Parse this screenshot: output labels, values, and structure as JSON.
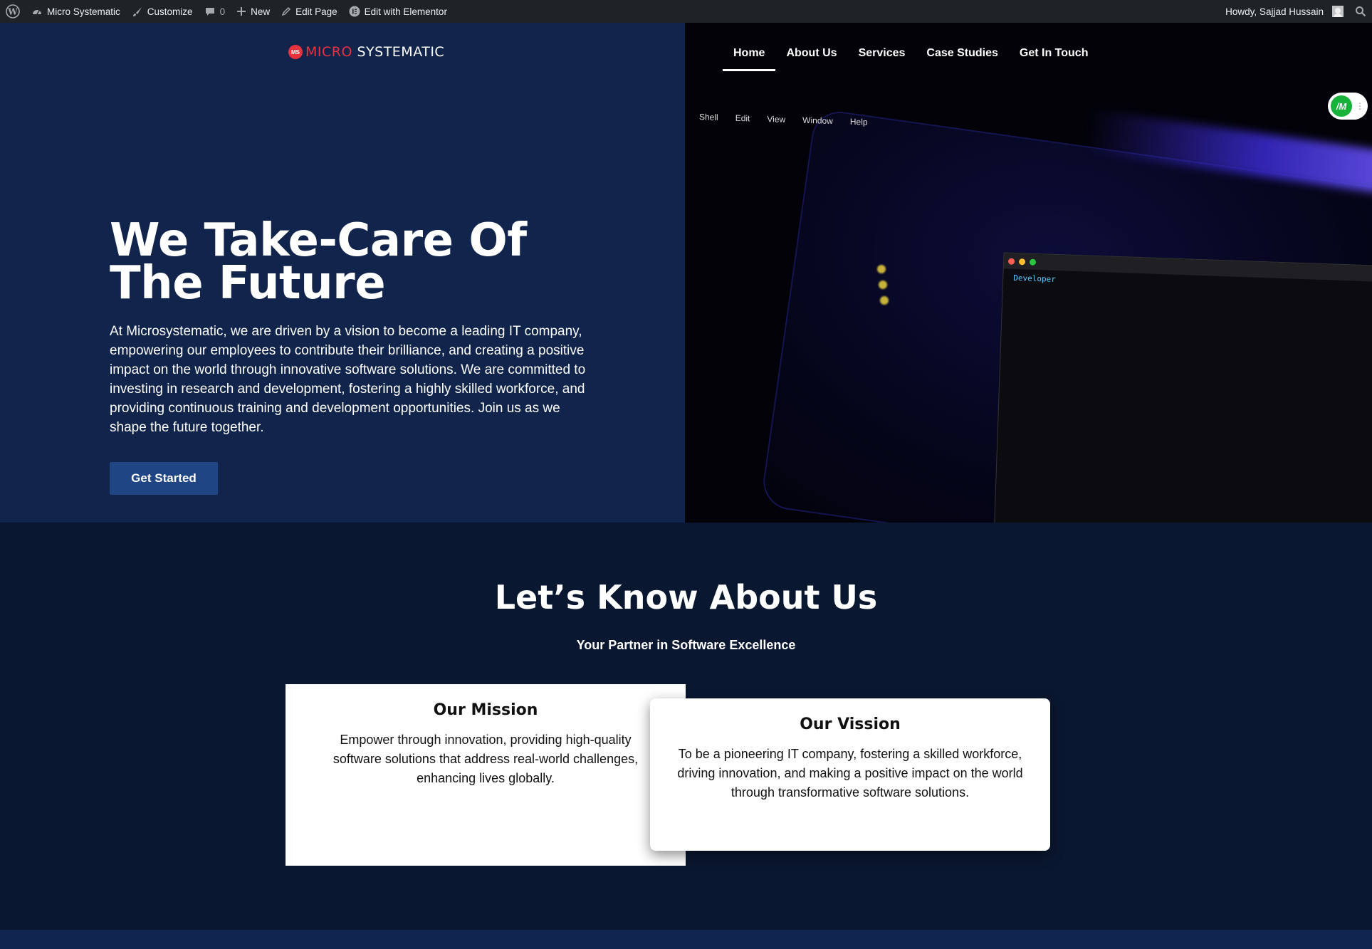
{
  "adminbar": {
    "site_name": "Micro Systematic",
    "customize": "Customize",
    "comments_count": "0",
    "new": "New",
    "edit_page": "Edit Page",
    "edit_elementor": "Edit with Elementor",
    "howdy": "Howdy, Sajjad Hussain"
  },
  "logo": {
    "part1": "MICRO",
    "part2": " SYSTEMATIC",
    "mark": "MS"
  },
  "nav": {
    "items": [
      {
        "label": "Home"
      },
      {
        "label": "About Us"
      },
      {
        "label": "Services"
      },
      {
        "label": "Case Studies"
      },
      {
        "label": "Get In Touch"
      }
    ]
  },
  "hero": {
    "title": "We Take-Care Of The Future",
    "text": "At Microsystematic, we are driven by a vision to become a leading IT company, empowering our employees to contribute their brilliance, and creating a positive impact on the world through innovative software solutions. We are committed to investing in research and development, fostering a highly skilled workforce, and providing continuous training and development opportunities. Join us as we shape the future together.",
    "button": "Get Started",
    "image_menu": [
      "Shell",
      "Edit",
      "View",
      "Window",
      "Help"
    ],
    "terminal_text": "Developer"
  },
  "widget": {
    "logo": "/M"
  },
  "about": {
    "title": "Let’s Know About Us",
    "subtitle": "Your Partner in Software Excellence",
    "mission": {
      "title": "Our Mission",
      "text": "Empower through innovation, providing high-quality software solutions that address real-world challenges, enhancing lives globally."
    },
    "vision": {
      "title": "Our Vission",
      "text": "To be a pioneering IT company, fostering a skilled workforce, driving innovation, and making a positive impact on the world through transformative software solutions."
    }
  },
  "colors": {
    "hero_bg": "#11244b",
    "section_bg": "#0a1730",
    "button_bg": "#1f4585",
    "logo_red": "#e8333d",
    "adminbar_bg": "#1d2327"
  }
}
